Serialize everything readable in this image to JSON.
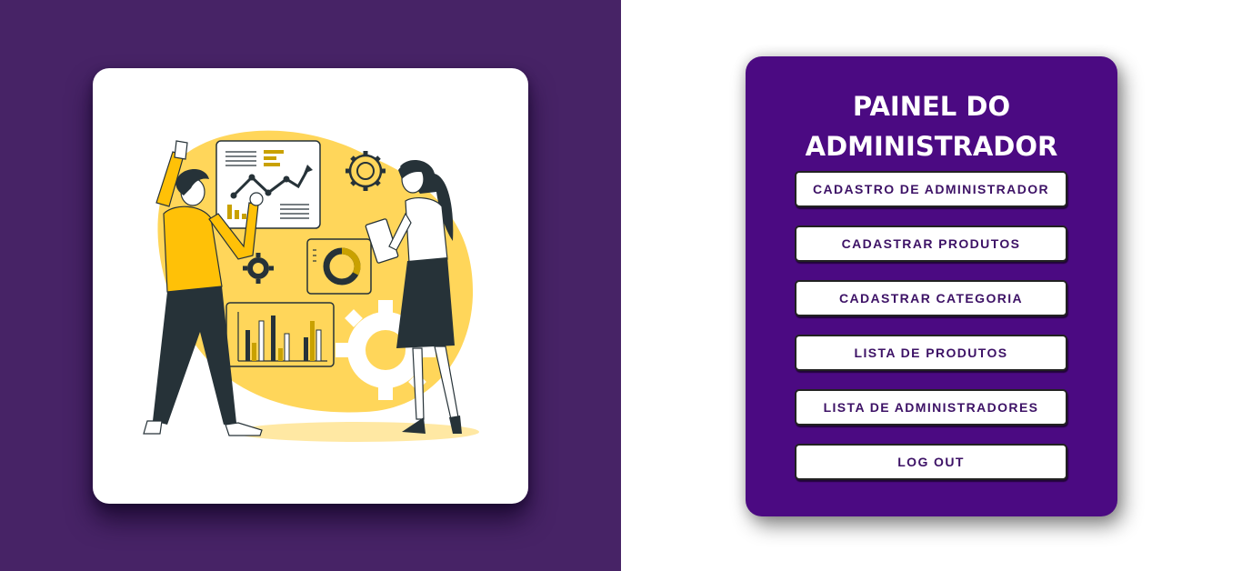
{
  "page": {
    "left_background": "#472366",
    "right_background": "#ffffff"
  },
  "illustration": {
    "icon": "business-analytics-illustration",
    "accent": "#ffd65a",
    "accent_dark": "#c9a100",
    "ink": "#263238"
  },
  "admin_panel": {
    "title_line1": "PAINEL DO",
    "title_line2": "ADMINISTRADOR",
    "background": "#4b0a82",
    "buttons": [
      {
        "label": "CADASTRO DE ADMINISTRADOR"
      },
      {
        "label": "CADASTRAR PRODUTOS"
      },
      {
        "label": "CADASTRAR CATEGORIA"
      },
      {
        "label": "LISTA DE PRODUTOS"
      },
      {
        "label": "LISTA DE ADMINISTRADORES"
      },
      {
        "label": "LOG OUT"
      }
    ]
  }
}
